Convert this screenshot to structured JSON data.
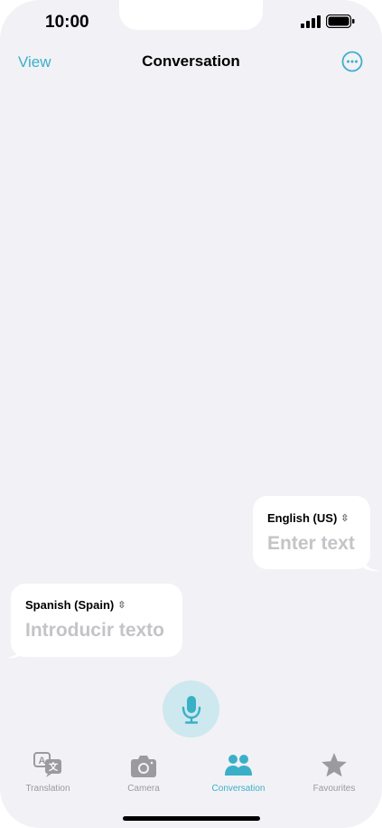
{
  "status_bar": {
    "time": "10:00"
  },
  "nav": {
    "left_label": "View",
    "title": "Conversation",
    "more_icon": "ellipsis-circle-icon"
  },
  "bubbles": {
    "english": {
      "language": "English (US)",
      "placeholder": "Enter text"
    },
    "spanish": {
      "language": "Spanish (Spain)",
      "placeholder": "Introducir texto"
    }
  },
  "mic": {
    "icon": "microphone-icon"
  },
  "tabs": [
    {
      "label": "Translation",
      "icon": "translate-icon",
      "active": false
    },
    {
      "label": "Camera",
      "icon": "camera-icon",
      "active": false
    },
    {
      "label": "Conversation",
      "icon": "people-icon",
      "active": true
    },
    {
      "label": "Favourites",
      "icon": "star-icon",
      "active": false
    }
  ],
  "colors": {
    "accent": "#3ab0c8",
    "background": "#f2f1f6",
    "inactive": "#9a9a9f",
    "mic_bg": "#cde8ee"
  }
}
